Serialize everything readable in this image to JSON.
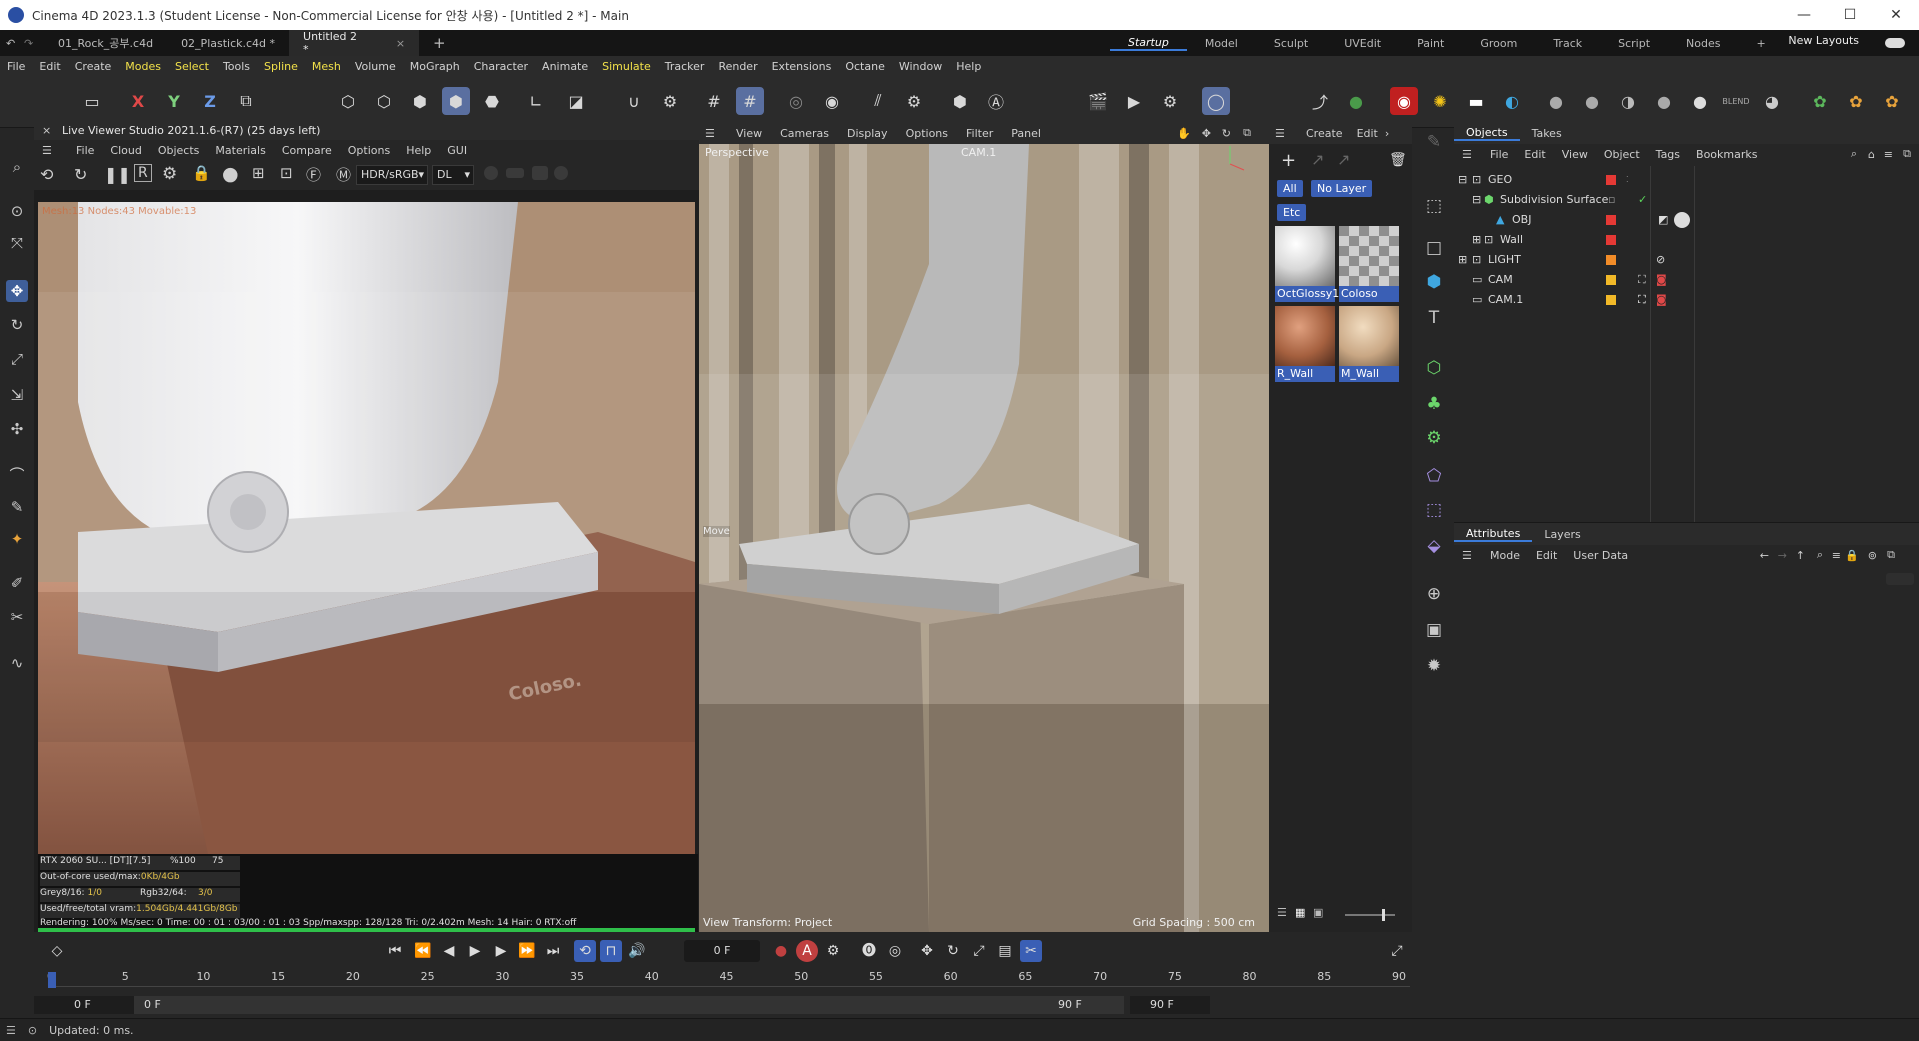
{
  "window": {
    "title": "Cinema 4D 2023.1.3 (Student License - Non-Commercial License for 안창 사용) - [Untitled 2 *] - Main",
    "controls": [
      "—",
      "☐",
      "✕"
    ]
  },
  "doc_tabs": [
    {
      "label": "01_Rock_공부.c4d"
    },
    {
      "label": "02_Plastick.c4d *"
    },
    {
      "label": "Untitled 2 *",
      "close": "×"
    }
  ],
  "layout_tabs": [
    "Startup",
    "Model",
    "Sculpt",
    "UVEdit",
    "Paint",
    "Groom",
    "Track",
    "Script",
    "Nodes"
  ],
  "new_layouts": "New Layouts",
  "menubar": [
    "File",
    "Edit",
    "Create",
    "Modes",
    "Select",
    "Tools",
    "Spline",
    "Mesh",
    "Volume",
    "MoGraph",
    "Character",
    "Animate",
    "Simulate",
    "Tracker",
    "Render",
    "Extensions",
    "Octane",
    "Window",
    "Help"
  ],
  "toolbar_axes": [
    "X",
    "Y",
    "Z"
  ],
  "live_viewer": {
    "title": "Live Viewer Studio 2021.1.6-(R7) (25 days left)",
    "menu": [
      "File",
      "Cloud",
      "Objects",
      "Materials",
      "Compare",
      "Options",
      "Help",
      "GUI"
    ],
    "color_space": "HDR/sRGB",
    "kernel": "DL",
    "overlay": "Mesh:13 Nodes:43 Movable:13",
    "watermark": "Coloso.",
    "stats": {
      "gpu": "RTX 2060 SU... [DT][7.5]",
      "gpu_pct": "%100",
      "gpu_temp": "75",
      "ooc_label": "Out-of-core used/max:",
      "ooc_value": "0Kb/4Gb",
      "grey_label": "Grey8/16:",
      "grey_value": "1/0",
      "rgb_label": "Rgb32/64:",
      "rgb_value": "3/0",
      "vram_label": "Used/free/total vram:",
      "vram_value": "1.504Gb/4.441Gb/8Gb",
      "rendering_line": "Rendering: 100%  Ms/sec: 0    Time: 00 : 01 : 03/00 : 01 : 03     Spp/maxspp: 128/128   Tri: 0/2.402m   Mesh: 14    Hair: 0    RTX:off"
    },
    "progress": 1.0
  },
  "viewport": {
    "menu": [
      "View",
      "Cameras",
      "Display",
      "Options",
      "Filter",
      "Panel"
    ],
    "camera_label": "Perspective",
    "active_camera": "CAM.1",
    "move_label": "Move",
    "view_transform": "View Transform: Project",
    "grid_spacing": "Grid Spacing : 500 cm"
  },
  "material_panel": {
    "menu": [
      "Create",
      "Edit"
    ],
    "filters": [
      "All",
      "No Layer",
      "Etc"
    ],
    "materials": [
      {
        "name": "OctGlossy1"
      },
      {
        "name": "Coloso"
      },
      {
        "name": "R_Wall"
      },
      {
        "name": "M_Wall"
      }
    ]
  },
  "objects_panel": {
    "tabs": [
      "Objects",
      "Takes"
    ],
    "menu": [
      "File",
      "Edit",
      "View",
      "Object",
      "Tags",
      "Bookmarks"
    ],
    "rows": [
      {
        "name": "GEO",
        "dot": "#e53935"
      },
      {
        "name": "Subdivision Surface",
        "dot": ""
      },
      {
        "name": "OBJ",
        "dot": "#e53935"
      },
      {
        "name": "Wall",
        "dot": "#e53935"
      },
      {
        "name": "LIGHT",
        "dot": "#f28c28"
      },
      {
        "name": "CAM",
        "dot": "#f2b928"
      },
      {
        "name": "CAM.1",
        "dot": "#f2b928"
      }
    ]
  },
  "attributes_panel": {
    "tabs": [
      "Attributes",
      "Layers"
    ],
    "menu": [
      "Mode",
      "Edit",
      "User Data"
    ]
  },
  "timeline": {
    "current_frame": "0 F",
    "ticks": [
      "0",
      "5",
      "10",
      "15",
      "20",
      "25",
      "30",
      "35",
      "40",
      "45",
      "50",
      "55",
      "60",
      "65",
      "70",
      "75",
      "80",
      "85",
      "90"
    ],
    "start_field": "0 F",
    "min_field": "0 F",
    "max_field": "90 F",
    "end_field": "90 F"
  },
  "status": "Updated: 0 ms."
}
